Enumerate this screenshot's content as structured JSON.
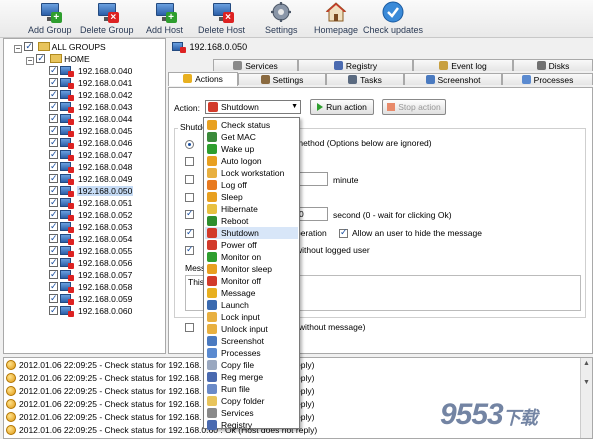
{
  "toolbar": {
    "add_group": "Add Group",
    "delete_group": "Delete Group",
    "add_host": "Add Host",
    "delete_host": "Delete Host",
    "settings": "Settings",
    "homepage": "Homepage",
    "check_updates": "Check updates"
  },
  "tree": {
    "root": "ALL GROUPS",
    "group": "HOME",
    "hosts": [
      "192.168.0.040",
      "192.168.0.041",
      "192.168.0.042",
      "192.168.0.043",
      "192.168.0.044",
      "192.168.0.045",
      "192.168.0.046",
      "192.168.0.047",
      "192.168.0.048",
      "192.168.0.049",
      "192.168.0.050",
      "192.168.0.051",
      "192.168.0.052",
      "192.168.0.053",
      "192.168.0.054",
      "192.168.0.055",
      "192.168.0.056",
      "192.168.0.057",
      "192.168.0.058",
      "192.168.0.059",
      "192.168.0.060"
    ],
    "selected_index": 10
  },
  "host_bar": {
    "host": "192.168.0.050"
  },
  "tabs": {
    "row1": [
      "Services",
      "Registry",
      "Event log",
      "Disks"
    ],
    "row2": [
      "Actions",
      "Settings",
      "Tasks",
      "Screenshot",
      "Processes"
    ],
    "active": "Actions"
  },
  "actions": {
    "action_label": "Action:",
    "action_value": "Shutdown",
    "run_action": "Run action",
    "stop_action": "Stop action",
    "group_label": "Shutdo",
    "method_suffix": "method (Options below are ignored)",
    "minute_label": "minute",
    "second_value": "0",
    "second_label": "second (0 - wait for clicking Ok)",
    "operation_label": "peration",
    "allow_hide": "Allow an user to hide the message",
    "without_user": "without logged user",
    "message_label": "Mess",
    "message_text": "This",
    "without_message": "(without message)"
  },
  "action_menu": [
    {
      "label": "Check status",
      "icon": "check-status-icon",
      "color": "#e8a020"
    },
    {
      "label": "Get MAC",
      "icon": "get-mac-icon",
      "color": "#3a8a3a"
    },
    {
      "label": "Wake up",
      "icon": "wake-up-icon",
      "color": "#2e9e2e"
    },
    {
      "label": "Auto logon",
      "icon": "auto-logon-icon",
      "color": "#e8a020"
    },
    {
      "label": "Lock workstation",
      "icon": "lock-workstation-icon",
      "color": "#e8b040"
    },
    {
      "label": "Log off",
      "icon": "log-off-icon",
      "color": "#e87a20"
    },
    {
      "label": "Sleep",
      "icon": "sleep-icon",
      "color": "#e8a020"
    },
    {
      "label": "Hibernate",
      "icon": "hibernate-icon",
      "color": "#e8c040"
    },
    {
      "label": "Reboot",
      "icon": "reboot-icon",
      "color": "#2e8e2e"
    },
    {
      "label": "Shutdown",
      "icon": "shutdown-icon",
      "color": "#d23a2a"
    },
    {
      "label": "Power off",
      "icon": "power-off-icon",
      "color": "#d23a2a"
    },
    {
      "label": "Monitor on",
      "icon": "monitor-on-icon",
      "color": "#2e9e2e"
    },
    {
      "label": "Monitor sleep",
      "icon": "monitor-sleep-icon",
      "color": "#e8a020"
    },
    {
      "label": "Monitor off",
      "icon": "monitor-off-icon",
      "color": "#d23a2a"
    },
    {
      "label": "Message",
      "icon": "message-icon",
      "color": "#e8b020"
    },
    {
      "label": "Launch",
      "icon": "launch-icon",
      "color": "#3a6ab0"
    },
    {
      "label": "Lock input",
      "icon": "lock-input-icon",
      "color": "#e8b040"
    },
    {
      "label": "Unlock input",
      "icon": "unlock-input-icon",
      "color": "#e8b040"
    },
    {
      "label": "Screenshot",
      "icon": "screenshot-icon",
      "color": "#4a7ac0"
    },
    {
      "label": "Processes",
      "icon": "processes-icon",
      "color": "#5a8ad0"
    },
    {
      "label": "Copy file",
      "icon": "copy-file-icon",
      "color": "#9aa8c0"
    },
    {
      "label": "Reg merge",
      "icon": "reg-merge-icon",
      "color": "#4a6ab0"
    },
    {
      "label": "Run file",
      "icon": "run-file-icon",
      "color": "#6a8ac8"
    },
    {
      "label": "Copy folder",
      "icon": "copy-folder-icon",
      "color": "#e8c45c"
    },
    {
      "label": "Services",
      "icon": "services-icon",
      "color": "#8a8a8a"
    },
    {
      "label": "Registry",
      "icon": "registry-icon",
      "color": "#4a6ab0"
    }
  ],
  "action_menu_highlighted": "Shutdown",
  "log": [
    {
      "left": "2012.01.06 22:09:25 - Check status for 192.168.",
      "right": "eply)"
    },
    {
      "left": "2012.01.06 22:09:25 - Check status for 192.168.",
      "right": "eply)"
    },
    {
      "left": "2012.01.06 22:09:25 - Check status for 192.168.",
      "right": "eply)"
    },
    {
      "left": "2012.01.06 22:09:25 - Check status for 192.168.",
      "right": "eply)"
    },
    {
      "left": "2012.01.06 22:09:25 - Check status for 192.168.",
      "right": "eply)"
    },
    {
      "left": "2012.01.06 22:09:25 - Check status for 192.168.0.60 : Ok (Host does not reply)",
      "right": ""
    }
  ],
  "watermark": {
    "main": "9553",
    "small": "下载"
  },
  "colors": {
    "selection": "#c6dcf6",
    "accent": "#1a4fa0",
    "menu_highlight": "#d8e6f8"
  }
}
